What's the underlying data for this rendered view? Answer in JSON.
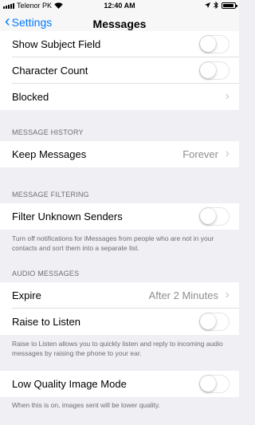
{
  "status": {
    "carrier": "Telenor PK",
    "time": "12:40 AM",
    "battery_level": 0.9
  },
  "nav": {
    "back_label": "Settings",
    "title": "Messages"
  },
  "rows": {
    "show_subject": {
      "label": "Show Subject Field",
      "on": false
    },
    "character_count": {
      "label": "Character Count",
      "on": false
    },
    "blocked": {
      "label": "Blocked"
    },
    "keep_messages": {
      "label": "Keep Messages",
      "value": "Forever"
    },
    "filter_unknown": {
      "label": "Filter Unknown Senders",
      "on": false
    },
    "expire": {
      "label": "Expire",
      "value": "After 2 Minutes"
    },
    "raise_to_listen": {
      "label": "Raise to Listen",
      "on": false
    },
    "low_quality": {
      "label": "Low Quality Image Mode",
      "on": false
    }
  },
  "sections": {
    "message_history": "MESSAGE HISTORY",
    "message_filtering": "MESSAGE FILTERING",
    "audio_messages": "AUDIO MESSAGES"
  },
  "footers": {
    "filter": "Turn off notifications for iMessages from people who are not in your contacts and sort them into a separate list.",
    "raise": "Raise to Listen allows you to quickly listen and reply to incoming audio messages by raising the phone to your ear.",
    "low_quality": "When this is on, images sent will be lower quality."
  },
  "colors": {
    "accent": "#007aff",
    "background": "#efeff4"
  }
}
